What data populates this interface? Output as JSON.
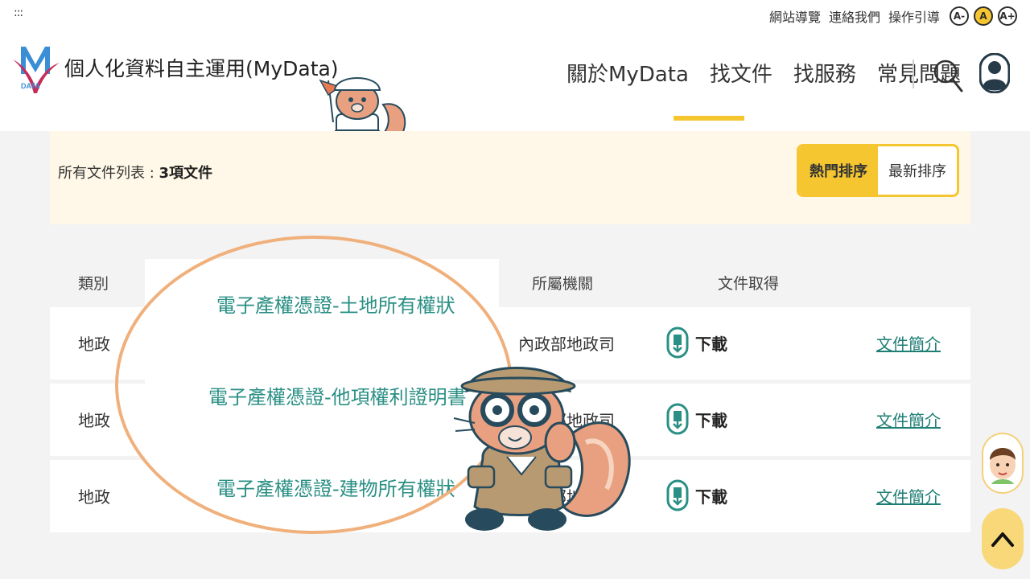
{
  "header": {
    "dots": ":::",
    "util_links": [
      "網站導覽",
      "連絡我們",
      "操作引導"
    ],
    "font_buttons": [
      "A-",
      "A",
      "A+"
    ],
    "site_title": "個人化資料自主運用(MyData)",
    "logo_text": "DATA",
    "nav": [
      "關於MyData",
      "找文件",
      "找服務",
      "常見問題"
    ],
    "active_nav": "找文件"
  },
  "list": {
    "count_label": "所有文件列表 : ",
    "count_value": "3項文件",
    "sort_hot": "熱門排序",
    "sort_new": "最新排序"
  },
  "table": {
    "headers": {
      "category": "類別",
      "agency": "所屬機關",
      "download": "文件取得"
    },
    "rows": [
      {
        "category": "地政",
        "name": "電子產權憑證-土地所有權狀",
        "agency": "內政部地政司",
        "download": "下載",
        "intro": "文件簡介"
      },
      {
        "category": "地政",
        "name": "電子產權憑證-他項權利證明書",
        "agency": "內政部地政司",
        "download": "下載",
        "intro": "文件簡介"
      },
      {
        "category": "地政",
        "name": "電子產權憑證-建物所有權狀",
        "agency": "內政部地政司",
        "download": "下載",
        "intro": "文件簡介"
      }
    ]
  },
  "colors": {
    "accent_yellow": "#f6c631",
    "teal": "#2a8f84",
    "highlight_orange": "#f0b07c",
    "cream": "#fff8e8"
  }
}
